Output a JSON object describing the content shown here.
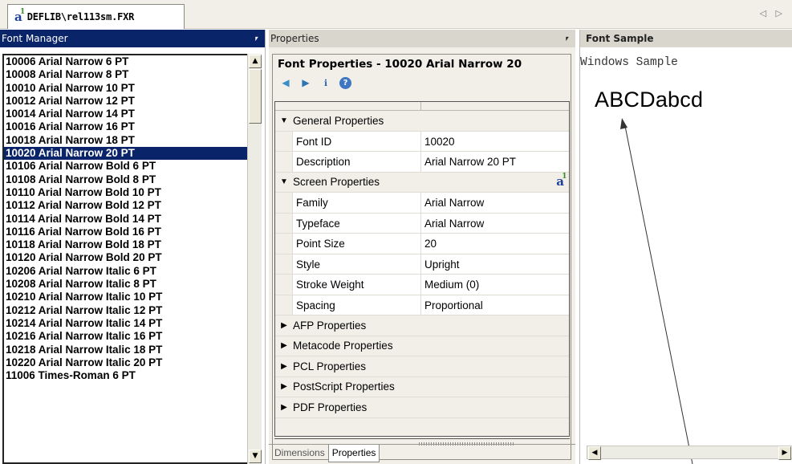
{
  "document_tab": {
    "title": "DEFLIB\\rel113sm.FXR",
    "nav": "◁ ▷"
  },
  "font_manager": {
    "title": "Font Manager",
    "pin": "ᵻ",
    "items": [
      "10006  Arial Narrow 6 PT",
      "10008  Arial Narrow 8 PT",
      "10010  Arial Narrow 10 PT",
      "10012  Arial Narrow 12 PT",
      "10014  Arial Narrow 14 PT",
      "10016  Arial Narrow 16 PT",
      "10018  Arial Narrow 18 PT",
      "10020  Arial Narrow 20 PT",
      "10106  Arial Narrow Bold 6 PT",
      "10108  Arial Narrow Bold 8 PT",
      "10110  Arial Narrow Bold 10 PT",
      "10112  Arial Narrow Bold 12 PT",
      "10114  Arial Narrow Bold 14 PT",
      "10116  Arial Narrow Bold 16 PT",
      "10118  Arial Narrow Bold 18 PT",
      "10120  Arial Narrow Bold 20 PT",
      "10206  Arial Narrow Italic 6 PT",
      "10208  Arial Narrow Italic 8 PT",
      "10210  Arial Narrow Italic 10 PT",
      "10212  Arial Narrow Italic 12 PT",
      "10214  Arial Narrow Italic 14 PT",
      "10216  Arial Narrow Italic 16 PT",
      "10218  Arial Narrow Italic 18 PT",
      "10220  Arial Narrow Italic 20 PT",
      "11006  Times-Roman 6 PT"
    ],
    "selected_index": 7
  },
  "properties": {
    "title": "Properties",
    "pin": "ᵻ",
    "heading": "Font Properties - 10020  Arial Narrow 20",
    "sections": [
      {
        "label": "General Properties",
        "expanded": true,
        "rows": [
          {
            "name": "Font ID",
            "value": "10020"
          },
          {
            "name": "Description",
            "value": "Arial Narrow 20 PT"
          }
        ]
      },
      {
        "label": "Screen Properties",
        "expanded": true,
        "has_icon": true,
        "rows": [
          {
            "name": "Family",
            "value": "Arial Narrow"
          },
          {
            "name": "Typeface",
            "value": "Arial Narrow"
          },
          {
            "name": "Point Size",
            "value": "20"
          },
          {
            "name": "Style",
            "value": "Upright"
          },
          {
            "name": "Stroke Weight",
            "value": "Medium (0)"
          },
          {
            "name": "Spacing",
            "value": "Proportional"
          }
        ]
      },
      {
        "label": "AFP Properties",
        "expanded": false,
        "rows": []
      },
      {
        "label": "Metacode Properties",
        "expanded": false,
        "rows": []
      },
      {
        "label": "PCL Properties",
        "expanded": false,
        "rows": []
      },
      {
        "label": "PostScript Properties",
        "expanded": false,
        "rows": []
      },
      {
        "label": "PDF Properties",
        "expanded": false,
        "rows": []
      }
    ],
    "bottom_tabs": [
      "Dimensions",
      "Properties"
    ],
    "active_bottom_tab": 1
  },
  "font_sample": {
    "title": "Font Sample",
    "caption": "Windows Sample",
    "sample_text": "ABCDabcd"
  },
  "colors": {
    "selection": "#0a246a",
    "panel": "#f1efe8",
    "header": "#d8d6cd"
  }
}
